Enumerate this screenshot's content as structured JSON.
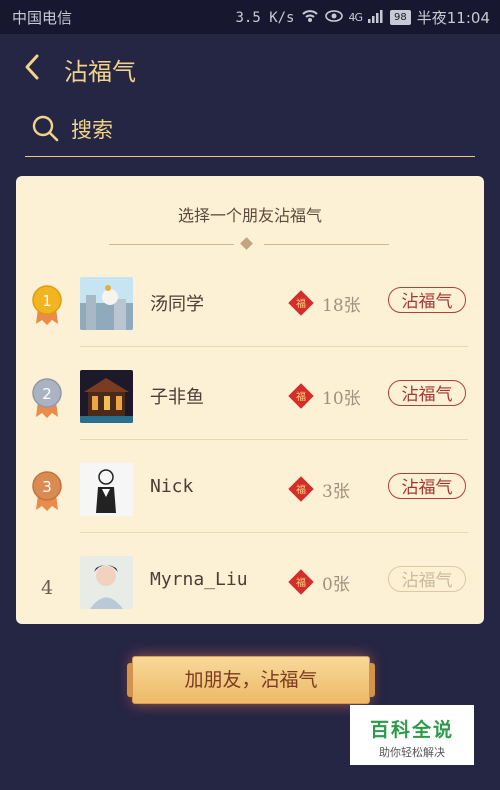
{
  "status_bar": {
    "carrier": "中国电信",
    "net_speed": "3.5 K/s",
    "signal": "4G",
    "battery": "98",
    "time": "半夜11:04"
  },
  "header": {
    "title": "沾福气",
    "back_icon": "chevron-left-icon"
  },
  "search": {
    "placeholder": "搜索",
    "value": "",
    "icon": "search-icon"
  },
  "card": {
    "title": "选择一个朋友沾福气",
    "friends": [
      {
        "rank": "1",
        "name": "汤同学",
        "count": "18张",
        "button": "沾福气",
        "button_enabled": true,
        "badge_color": "#f2b51f"
      },
      {
        "rank": "2",
        "name": "子非鱼",
        "count": "10张",
        "button": "沾福气",
        "button_enabled": true,
        "badge_color": "#aab3c2"
      },
      {
        "rank": "3",
        "name": "Nick",
        "count": "3张",
        "button": "沾福气",
        "button_enabled": true,
        "badge_color": "#d98b52"
      },
      {
        "rank": "4",
        "name": "Myrna_Liu",
        "count": "0张",
        "button": "沾福气",
        "button_enabled": false,
        "badge_color": ""
      }
    ]
  },
  "add_button": {
    "label": "加朋友，沾福气"
  },
  "watermark": {
    "title": "百科全说",
    "subtitle": "助你轻松解决"
  },
  "colors": {
    "background": "#252544",
    "accent": "#f1d48c",
    "card": "#fcf1d5",
    "button_red": "#b0403a"
  }
}
